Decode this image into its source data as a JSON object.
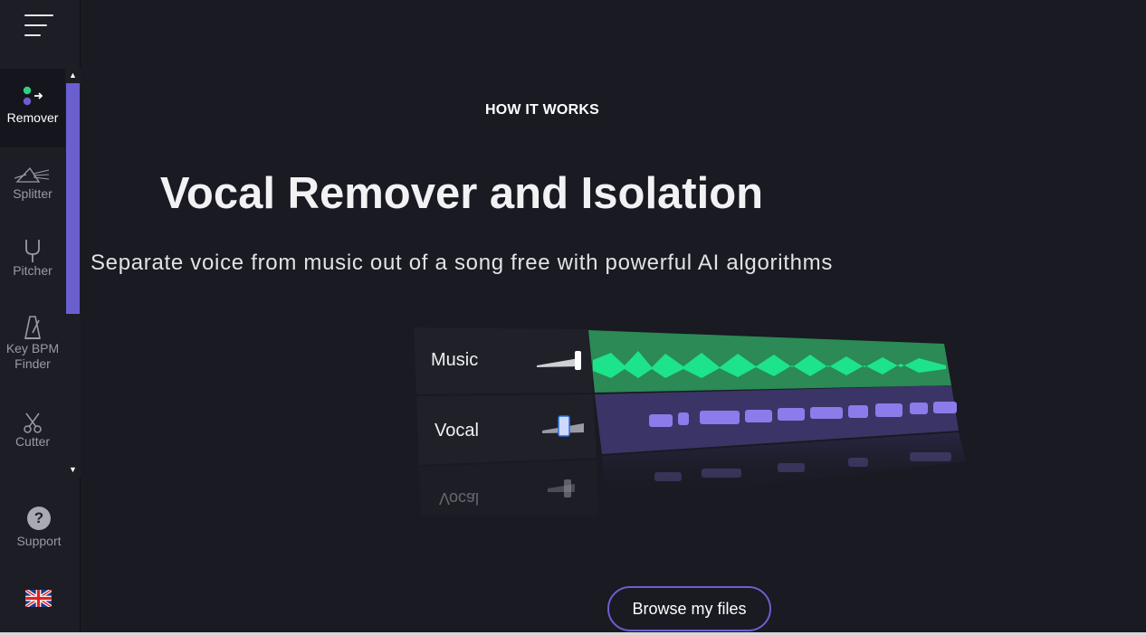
{
  "sidebar": {
    "menu_icon": "hamburger-menu-icon",
    "tools": [
      {
        "label": "Remover",
        "icon": "remover-icon",
        "active": true
      },
      {
        "label": "Splitter",
        "icon": "prism-icon",
        "active": false
      },
      {
        "label": "Pitcher",
        "icon": "tuning-fork-icon",
        "active": false
      },
      {
        "label": "Key BPM Finder",
        "icon": "metronome-icon",
        "active": false
      },
      {
        "label": "Cutter",
        "icon": "scissors-icon",
        "active": false
      }
    ],
    "support_label": "Support",
    "language_flag": "uk-flag-icon"
  },
  "main": {
    "eyebrow": "HOW IT WORKS",
    "title": "Vocal Remover and Isolation",
    "subtitle": "Separate voice from music out of a song free with powerful AI algorithms",
    "tracks": [
      {
        "label": "Music",
        "color": "#1de38a",
        "bg": "#2b8a55"
      },
      {
        "label": "Vocal",
        "color": "#8c7bea",
        "bg": "#3a3566"
      }
    ],
    "reflection_label": "Vocal",
    "browse_button": "Browse my files"
  },
  "colors": {
    "accent": "#6b5fd0",
    "background": "#191a22",
    "music_wave": "#1de38a",
    "vocal_wave": "#8c7bea"
  }
}
